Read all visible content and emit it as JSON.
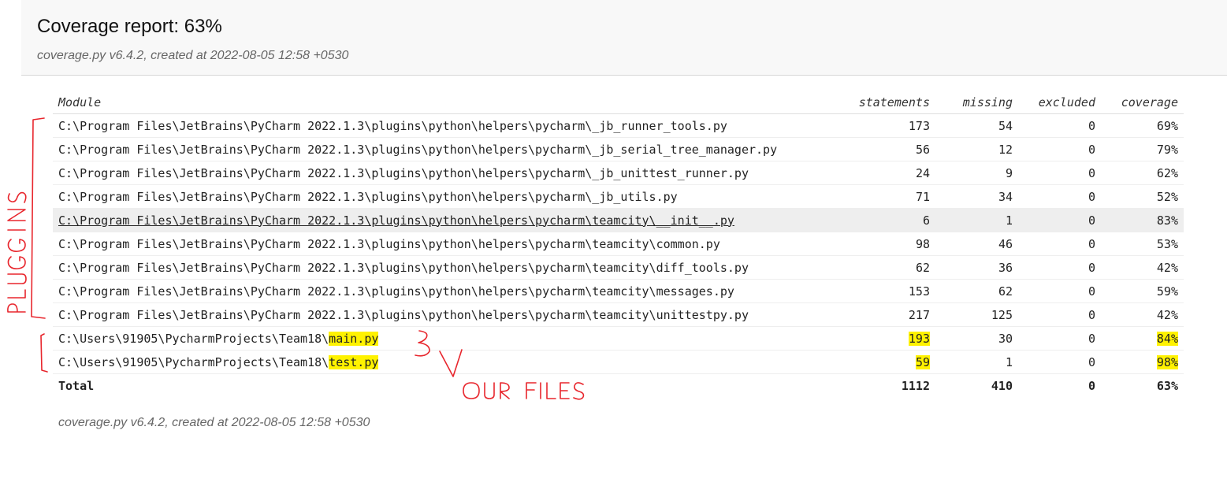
{
  "header": {
    "title": "Coverage report: 63%",
    "subtitle": "coverage.py v6.4.2, created at 2022-08-05 12:58 +0530"
  },
  "table": {
    "columns": [
      "Module",
      "statements",
      "missing",
      "excluded",
      "coverage"
    ],
    "rows": [
      {
        "module": "C:\\Program Files\\JetBrains\\PyCharm 2022.1.3\\plugins\\python\\helpers\\pycharm\\_jb_runner_tools.py",
        "statements": "173",
        "missing": "54",
        "excluded": "0",
        "coverage": "69%"
      },
      {
        "module": "C:\\Program Files\\JetBrains\\PyCharm 2022.1.3\\plugins\\python\\helpers\\pycharm\\_jb_serial_tree_manager.py",
        "statements": "56",
        "missing": "12",
        "excluded": "0",
        "coverage": "79%"
      },
      {
        "module": "C:\\Program Files\\JetBrains\\PyCharm 2022.1.3\\plugins\\python\\helpers\\pycharm\\_jb_unittest_runner.py",
        "statements": "24",
        "missing": "9",
        "excluded": "0",
        "coverage": "62%"
      },
      {
        "module": "C:\\Program Files\\JetBrains\\PyCharm 2022.1.3\\plugins\\python\\helpers\\pycharm\\_jb_utils.py",
        "statements": "71",
        "missing": "34",
        "excluded": "0",
        "coverage": "52%"
      },
      {
        "module": "C:\\Program Files\\JetBrains\\PyCharm 2022.1.3\\plugins\\python\\helpers\\pycharm\\teamcity\\__init__.py",
        "statements": "6",
        "missing": "1",
        "excluded": "0",
        "coverage": "83%"
      },
      {
        "module": "C:\\Program Files\\JetBrains\\PyCharm 2022.1.3\\plugins\\python\\helpers\\pycharm\\teamcity\\common.py",
        "statements": "98",
        "missing": "46",
        "excluded": "0",
        "coverage": "53%"
      },
      {
        "module": "C:\\Program Files\\JetBrains\\PyCharm 2022.1.3\\plugins\\python\\helpers\\pycharm\\teamcity\\diff_tools.py",
        "statements": "62",
        "missing": "36",
        "excluded": "0",
        "coverage": "42%"
      },
      {
        "module": "C:\\Program Files\\JetBrains\\PyCharm 2022.1.3\\plugins\\python\\helpers\\pycharm\\teamcity\\messages.py",
        "statements": "153",
        "missing": "62",
        "excluded": "0",
        "coverage": "59%"
      },
      {
        "module": "C:\\Program Files\\JetBrains\\PyCharm 2022.1.3\\plugins\\python\\helpers\\pycharm\\teamcity\\unittestpy.py",
        "statements": "217",
        "missing": "125",
        "excluded": "0",
        "coverage": "42%"
      }
    ],
    "own_rows": [
      {
        "module_prefix": "C:\\Users\\91905\\PycharmProjects\\Team18\\",
        "module_file": "main.py",
        "statements": "193",
        "missing": "30",
        "excluded": "0",
        "coverage": "84%"
      },
      {
        "module_prefix": "C:\\Users\\91905\\PycharmProjects\\Team18\\",
        "module_file": "test.py",
        "statements": "59",
        "missing": "1",
        "excluded": "0",
        "coverage": "98%"
      }
    ],
    "total": {
      "label": "Total",
      "statements": "1112",
      "missing": "410",
      "excluded": "0",
      "coverage": "63%"
    }
  },
  "footer": {
    "text": "coverage.py v6.4.2, created at 2022-08-05 12:58 +0530"
  },
  "annotations": {
    "plugins_label": "PLUGGINS",
    "our_files_label": "OUR FILES",
    "ink_color": "#e8262d",
    "highlight_color": "#fff200"
  }
}
